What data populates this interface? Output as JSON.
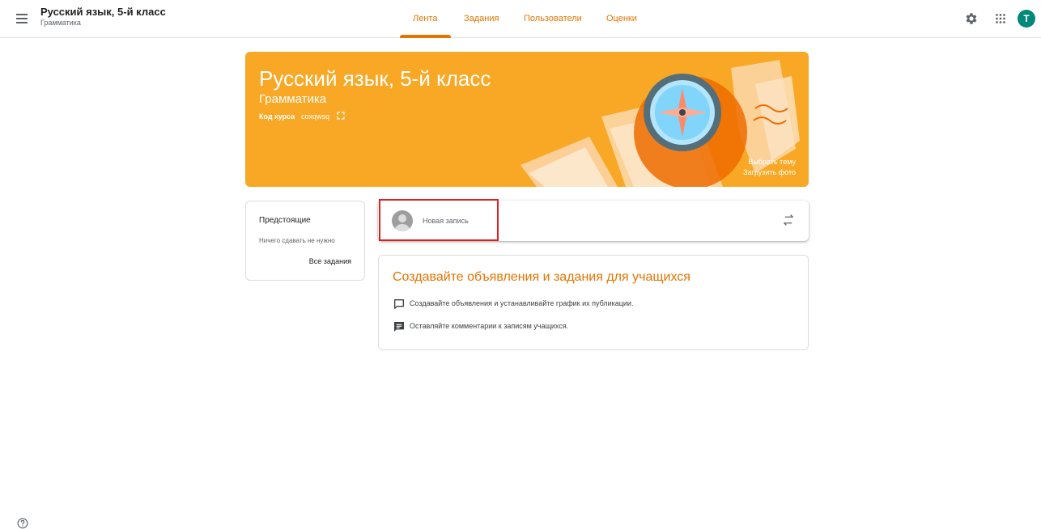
{
  "header": {
    "course_title": "Русский язык, 5-й класс",
    "course_subtitle": "Грамматика",
    "tabs": [
      {
        "label": "Лента",
        "active": true
      },
      {
        "label": "Задания"
      },
      {
        "label": "Пользователи"
      },
      {
        "label": "Оценки"
      }
    ],
    "avatar_letter": "T",
    "accent_color": "#e37400"
  },
  "banner": {
    "title": "Русский язык, 5-й класс",
    "subtitle": "Грамматика",
    "code_label": "Код курса",
    "code_value": "coxqwsq",
    "select_theme": "Выбрать тему",
    "upload_photo": "Загрузить фото",
    "color": "#f9a825"
  },
  "upcoming": {
    "title": "Предстоящие",
    "empty_text": "Ничего сдавать не нужно",
    "all_link": "Все задания"
  },
  "new_post": {
    "placeholder": "Новая запись"
  },
  "info": {
    "title": "Создавайте объявления и задания для учащихся",
    "items": [
      {
        "icon": "announcement-icon",
        "text": "Создавайте объявления и устанавливайте график их публикации."
      },
      {
        "icon": "comment-icon",
        "text": "Оставляйте комментарии к записям учащихся."
      }
    ]
  },
  "icons": [
    "menu-icon",
    "settings-icon",
    "apps-icon",
    "fullscreen-icon",
    "reuse-post-icon",
    "help-icon"
  ]
}
